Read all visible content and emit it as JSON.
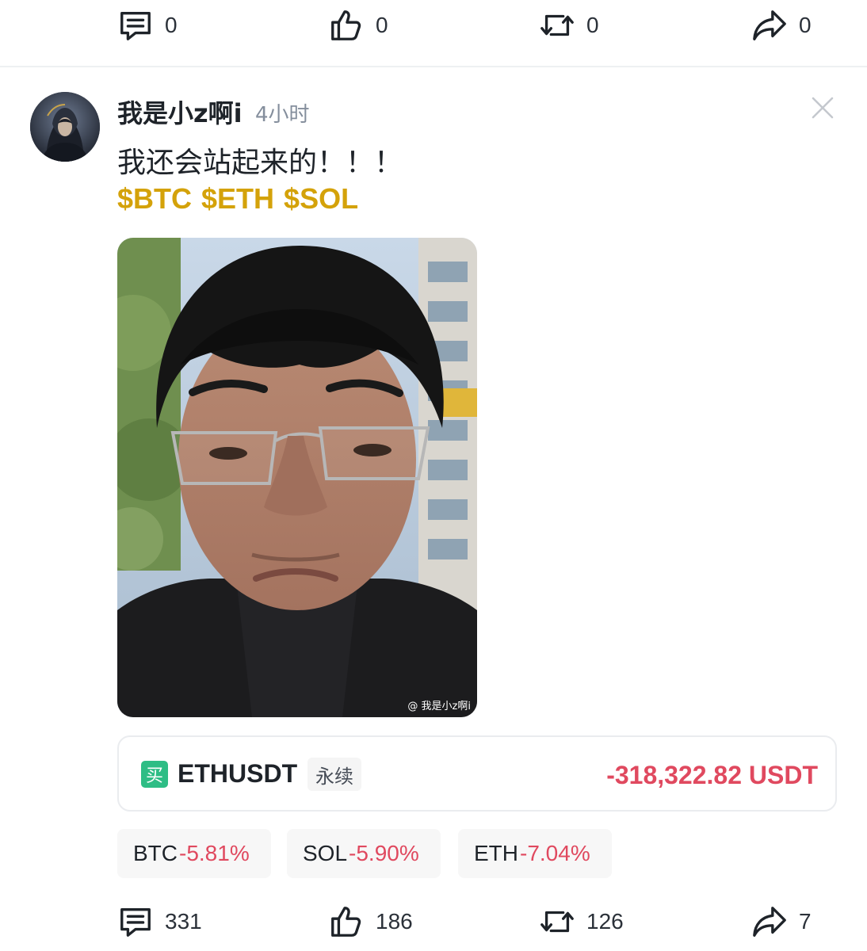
{
  "top_actions": {
    "comments": "0",
    "likes": "0",
    "reposts": "0",
    "shares": "0"
  },
  "post": {
    "username": "我是小z啊i",
    "time": "4小时",
    "text": "我还会站起来的！！！",
    "tags": [
      "$BTC",
      "$ETH",
      "$SOL"
    ],
    "image_watermark": "@ 我是小z啊i",
    "position": {
      "side_badge": "买",
      "pair": "ETHUSDT",
      "contract_type": "永续",
      "pnl": "-318,322.82 USDT"
    },
    "coin_chips": [
      {
        "symbol": "BTC",
        "change": "-5.81%"
      },
      {
        "symbol": "SOL",
        "change": "-5.90%"
      },
      {
        "symbol": "ETH",
        "change": "-7.04%"
      }
    ]
  },
  "bottom_actions": {
    "comments": "331",
    "likes": "186",
    "reposts": "126",
    "shares": "7"
  },
  "colors": {
    "tag": "#d4a20a",
    "negative": "#e0495f",
    "buy": "#2ebd85"
  }
}
